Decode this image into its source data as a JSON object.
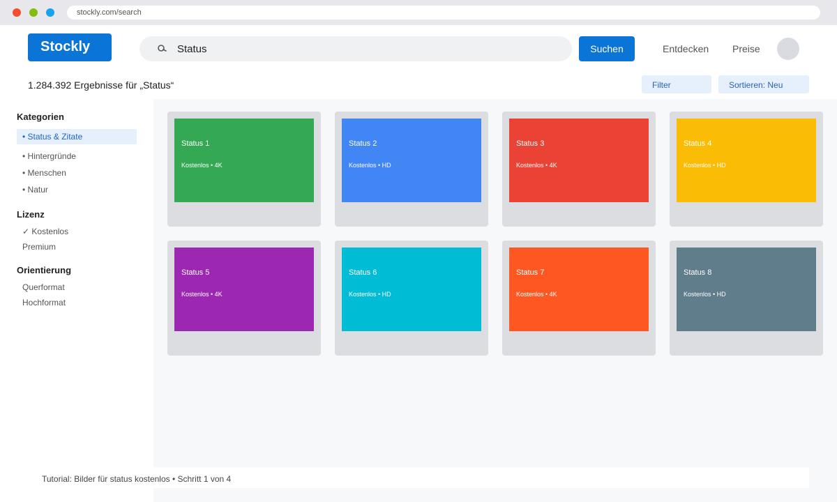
{
  "browser": {
    "url": "stockly.com/search"
  },
  "header": {
    "logo": "Stockly",
    "search_value": "Status",
    "search_button": "Suchen",
    "nav": [
      "Entdecken",
      "Preise"
    ]
  },
  "results": {
    "count_text": "1.284.392 Ergebnisse für „Status“",
    "filter_label": "Filter",
    "sort_label": "Sortieren: Neu"
  },
  "sidebar": {
    "categories_heading": "Kategorien",
    "categories": [
      "• Status & Zitate",
      "• Hintergründe",
      "• Menschen",
      "• Natur"
    ],
    "license_heading": "Lizenz",
    "license_options": [
      "✓ Kostenlos",
      "Premium"
    ],
    "orientation_heading": "Orientierung",
    "orientation_options": [
      "Querformat",
      "Hochformat"
    ]
  },
  "cards": [
    {
      "title": "Status 1",
      "meta": "Kostenlos • 4K",
      "color": "#34a853"
    },
    {
      "title": "Status 2",
      "meta": "Kostenlos • HD",
      "color": "#4285f4"
    },
    {
      "title": "Status 3",
      "meta": "Kostenlos • 4K",
      "color": "#ea4335"
    },
    {
      "title": "Status 4",
      "meta": "Kostenlos • HD",
      "color": "#fbbc05"
    },
    {
      "title": "Status 5",
      "meta": "Kostenlos • 4K",
      "color": "#9c27b0"
    },
    {
      "title": "Status 6",
      "meta": "Kostenlos • HD",
      "color": "#00bcd4"
    },
    {
      "title": "Status 7",
      "meta": "Kostenlos • 4K",
      "color": "#ff5722"
    },
    {
      "title": "Status 8",
      "meta": "Kostenlos • HD",
      "color": "#607d8b"
    }
  ],
  "tutorial": "Tutorial: Bilder für status kostenlos • Schritt 1 von 4"
}
